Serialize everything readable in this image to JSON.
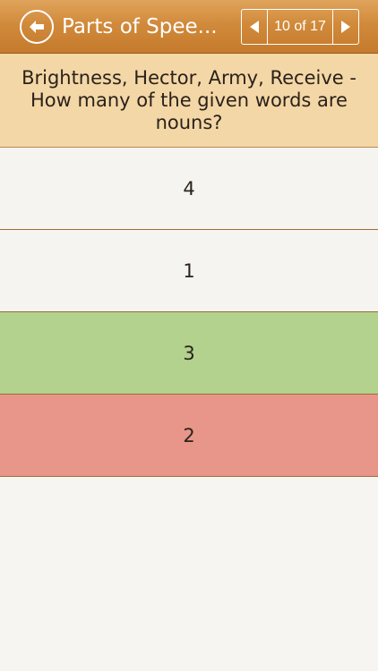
{
  "header": {
    "title": "Parts of Spee...",
    "back_icon": "arrow-left-circle-icon",
    "pager": {
      "count_label": "10 of 17",
      "prev_icon": "triangle-left-icon",
      "next_icon": "triangle-right-icon"
    }
  },
  "question": {
    "text": "Brightness, Hector, Army, Receive - How many of the given words are nouns?"
  },
  "answers": [
    {
      "label": "4",
      "state": "neutral"
    },
    {
      "label": "1",
      "state": "neutral"
    },
    {
      "label": "3",
      "state": "correct"
    },
    {
      "label": "2",
      "state": "wrong"
    }
  ],
  "colors": {
    "header": "#d18a3b",
    "question_bg": "#f4d7a6",
    "correct": "#b3d28d",
    "wrong": "#e8968a",
    "neutral": "#f5f4f1"
  }
}
